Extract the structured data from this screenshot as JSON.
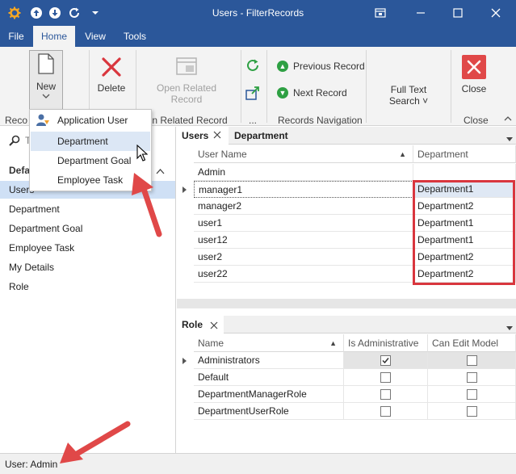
{
  "window": {
    "title": "Users - FilterRecords"
  },
  "ribbon_tabs": [
    "File",
    "Home",
    "View",
    "Tools"
  ],
  "ribbon": {
    "new_label": "New",
    "delete_label": "Delete",
    "open_related_label_1": "Open Related",
    "open_related_label_2": "Record",
    "previous_record_label": "Previous Record",
    "next_record_label": "Next Record",
    "full_text_search_label_1": "Full Text",
    "full_text_search_label_2": "Search",
    "close_label": "Close",
    "groups": {
      "records_fragment": "Reco",
      "open_related_fragment": "pen Related Record",
      "ellipsis": "...",
      "records_navigation": "Records Navigation",
      "close": "Close"
    }
  },
  "new_dropdown": {
    "items": [
      "Application User",
      "Department",
      "Department Goal",
      "Employee Task"
    ]
  },
  "leftnav": {
    "search_fragment": "T",
    "group_header_fragment": "Defa",
    "items": [
      "Users",
      "Department",
      "Department Goal",
      "Employee Task",
      "My Details",
      "Role"
    ]
  },
  "users_panel": {
    "tabs": [
      "Users",
      "Department"
    ],
    "columns": [
      "User Name",
      "Department"
    ],
    "rows": [
      {
        "name": "Admin",
        "department": ""
      },
      {
        "name": "manager1",
        "department": "Department1"
      },
      {
        "name": "manager2",
        "department": "Department2"
      },
      {
        "name": "user1",
        "department": "Department1"
      },
      {
        "name": "user12",
        "department": "Department1"
      },
      {
        "name": "user2",
        "department": "Department2"
      },
      {
        "name": "user22",
        "department": "Department2"
      }
    ]
  },
  "role_panel": {
    "tab": "Role",
    "columns": [
      "Name",
      "Is Administrative",
      "Can Edit Model"
    ],
    "rows": [
      {
        "name": "Administrators",
        "is_admin": true,
        "can_edit": false
      },
      {
        "name": "Default",
        "is_admin": false,
        "can_edit": false
      },
      {
        "name": "DepartmentManagerRole",
        "is_admin": false,
        "can_edit": false
      },
      {
        "name": "DepartmentUserRole",
        "is_admin": false,
        "can_edit": false
      }
    ]
  },
  "statusbar": {
    "text": "User: Admin"
  },
  "colors": {
    "accent": "#2b579a",
    "highlight_red": "#d9363e",
    "selection": "#cfe0f5"
  }
}
